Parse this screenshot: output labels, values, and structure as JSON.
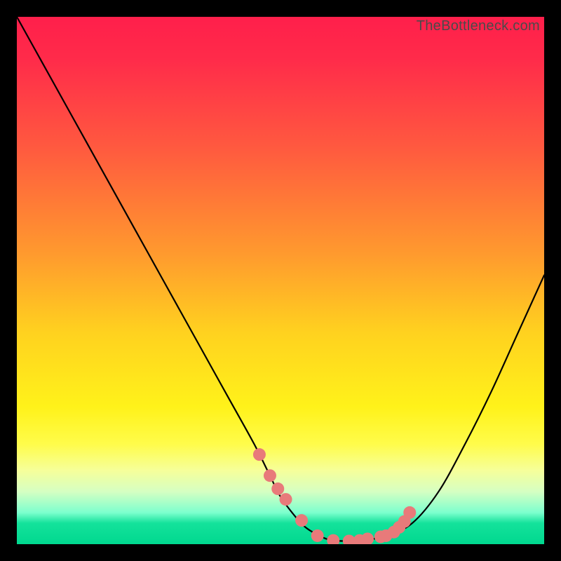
{
  "watermark": "TheBottleneck.com",
  "chart_data": {
    "type": "line",
    "title": "",
    "xlabel": "",
    "ylabel": "",
    "xlim": [
      0,
      100
    ],
    "ylim": [
      0,
      100
    ],
    "series": [
      {
        "name": "bottleneck-curve",
        "x": [
          0,
          5,
          10,
          15,
          20,
          25,
          30,
          35,
          40,
          45,
          48,
          50,
          53,
          55,
          58,
          60,
          63,
          65,
          70,
          75,
          80,
          85,
          90,
          95,
          100
        ],
        "y": [
          100,
          91,
          82,
          73,
          64,
          55,
          46,
          37,
          28,
          19,
          13,
          9,
          5,
          3,
          1.3,
          0.7,
          0.6,
          0.7,
          1.5,
          4,
          10,
          19,
          29,
          40,
          51
        ]
      }
    ],
    "markers": {
      "name": "highlight-dots",
      "color": "#e87a7a",
      "x": [
        46,
        48,
        49.5,
        51,
        54,
        57,
        60,
        63,
        65,
        66.5,
        69,
        70,
        71.5,
        72.5,
        73.5,
        74.5
      ],
      "y": [
        17,
        13,
        10.5,
        8.5,
        4.5,
        1.6,
        0.7,
        0.6,
        0.7,
        1.0,
        1.4,
        1.6,
        2.3,
        3.2,
        4.3,
        6.0
      ]
    },
    "gradient_stops": [
      {
        "pos": 0,
        "color": "#ff1f4b"
      },
      {
        "pos": 25,
        "color": "#ff5a3f"
      },
      {
        "pos": 60,
        "color": "#ffd21f"
      },
      {
        "pos": 86,
        "color": "#f6ff9a"
      },
      {
        "pos": 100,
        "color": "#00d88f"
      }
    ]
  }
}
